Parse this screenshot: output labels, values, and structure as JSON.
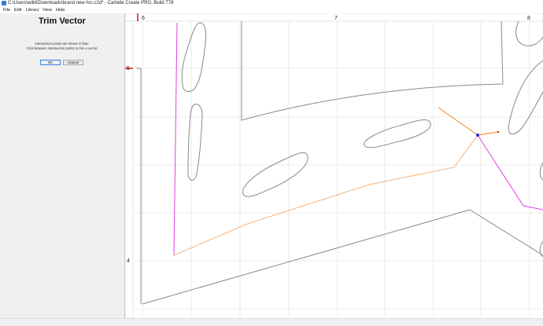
{
  "window": {
    "title": "C:\\Users\\willd\\Downloads\\brand new hrc.c2d* - Carbide Create PRO, Build 778",
    "icon": "carbide-create-icon"
  },
  "menu": {
    "items": [
      "File",
      "Edit",
      "Library",
      "View",
      "Help"
    ]
  },
  "panel": {
    "title": "Trim Vector",
    "instruction_1": "Intersection points are shown in blue.",
    "instruction_2": "Click between intersection points to trim a vector.",
    "ok_label": "OK",
    "cancel_label": "Cancel"
  },
  "ruler": {
    "top_labels": [
      "6",
      "7",
      "8"
    ],
    "left_labels": [
      "5",
      "4"
    ]
  },
  "colors": {
    "accent": "#3b7de0",
    "selection_orange": "#f08020",
    "vector_magenta": "#e040e0",
    "intersection_blue": "#3030c0",
    "vector_gray": "#888888"
  }
}
